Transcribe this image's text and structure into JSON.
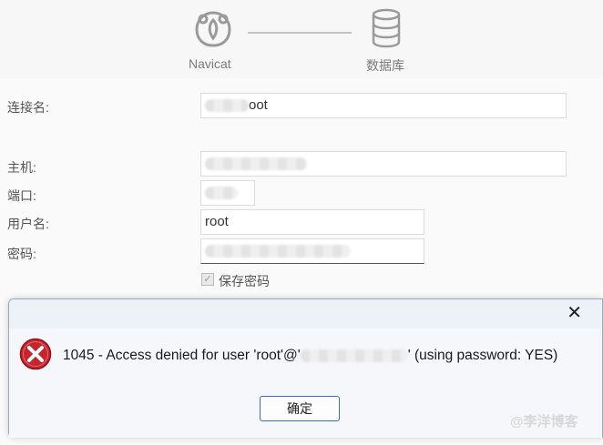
{
  "header": {
    "navicat_caption": "Navicat",
    "database_caption": "数据库"
  },
  "form": {
    "connection_name_label": "连接名:",
    "connection_name_value": "oot",
    "host_label": "主机:",
    "port_label": "端口:",
    "username_label": "用户名:",
    "username_value": "root",
    "password_label": "密码:",
    "save_password_label": "保存密码",
    "save_password_checked": true
  },
  "dialog": {
    "message_prefix": "1045 - Access denied for user 'root'@'",
    "message_suffix": "' (using password: YES)",
    "ok_label": "确定",
    "close_glyph": "✕"
  },
  "watermark": "@李洋博客",
  "colors": {
    "error_red": "#c4262e",
    "button_border": "#3c6fc1",
    "titlebar": "#edf1f8"
  }
}
